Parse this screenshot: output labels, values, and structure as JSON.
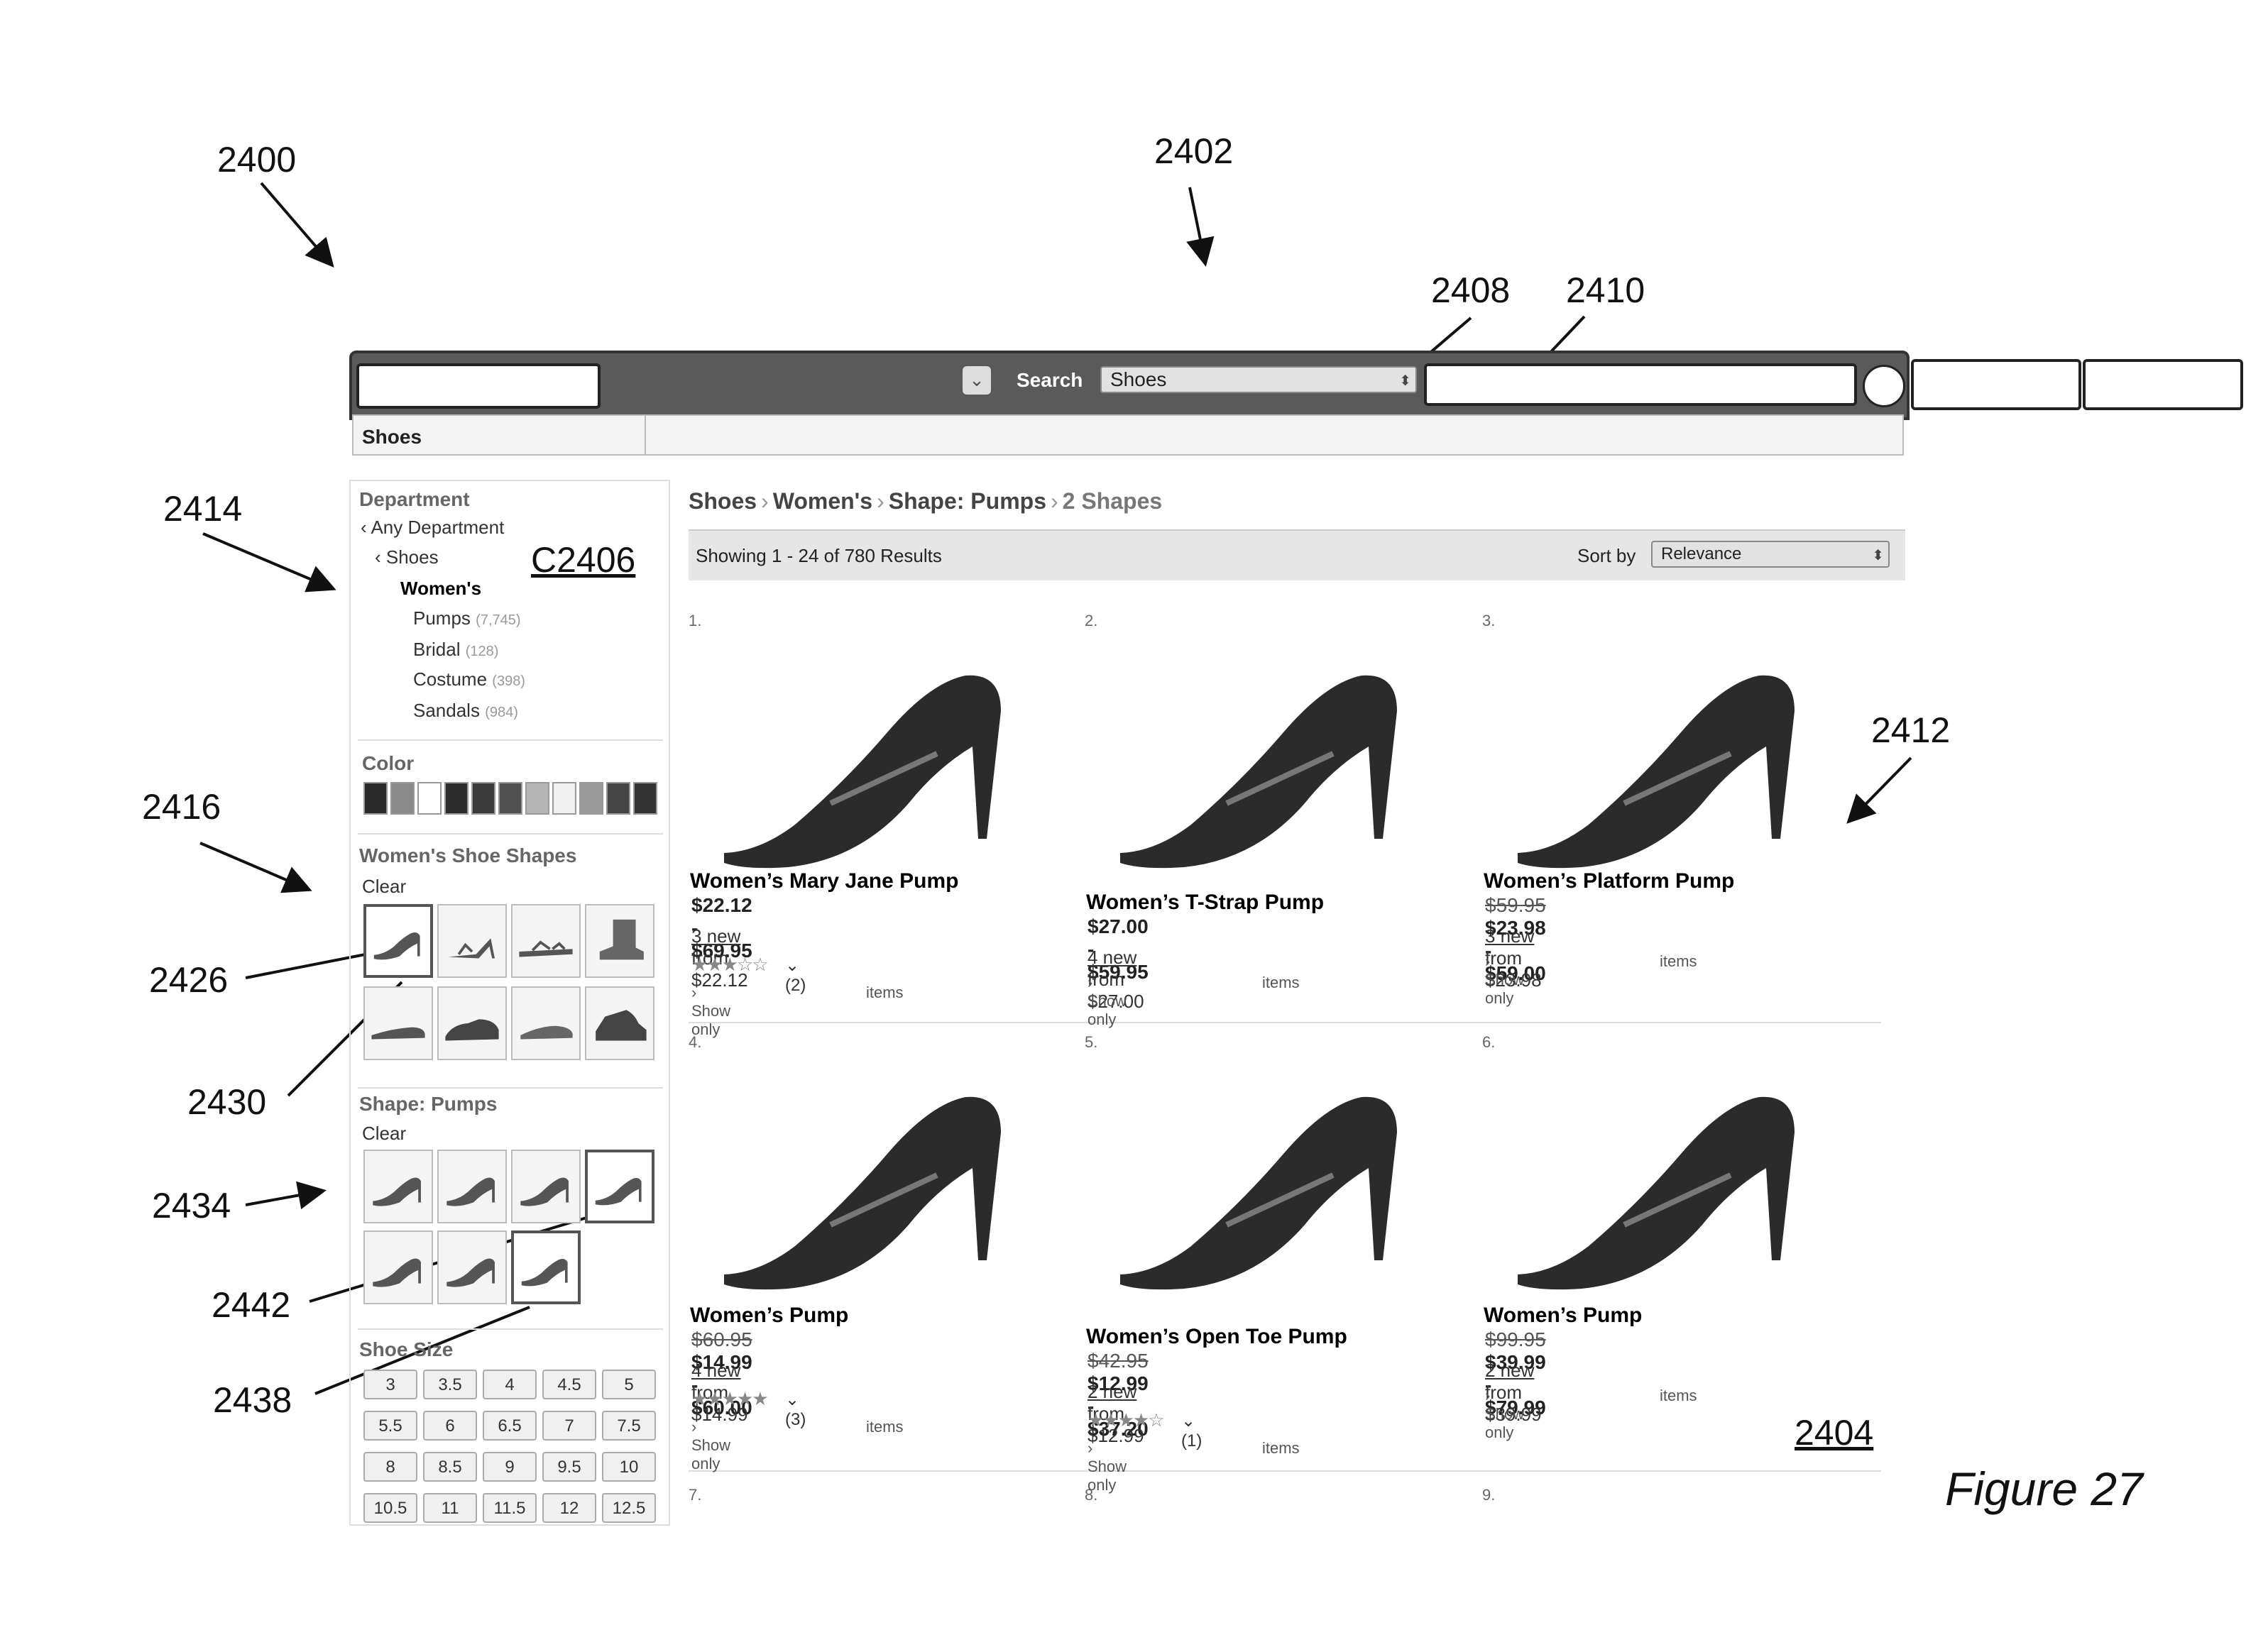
{
  "refs": {
    "r2400": "2400",
    "r2402": "2402",
    "r2408": "2408",
    "r2410": "2410",
    "r2414": "2414",
    "r2416": "2416",
    "r2426": "2426",
    "r2430": "2430",
    "r2434": "2434",
    "r2442": "2442",
    "r2438": "2438",
    "r2412": "2412",
    "c2406": "C2406",
    "r2404": "2404"
  },
  "figure_label": "Figure 27",
  "header": {
    "search_label": "Search",
    "category_value": "Shoes",
    "subtab": "Shoes"
  },
  "sidebar": {
    "department_heading": "Department",
    "any_department": "‹ Any Department",
    "shoes": "‹ Shoes",
    "womens": "Women's",
    "categories": [
      {
        "label": "Pumps",
        "count": "(7,745)"
      },
      {
        "label": "Bridal",
        "count": "(128)"
      },
      {
        "label": "Costume",
        "count": "(398)"
      },
      {
        "label": "Sandals",
        "count": "(984)"
      }
    ],
    "color_heading": "Color",
    "colors": [
      "#2a2a2a",
      "#8a8a8a",
      "#ffffff",
      "#2c2c2c",
      "#3a3a3a",
      "#505050",
      "#b5b5b5",
      "#efefef",
      "#9a9a9a",
      "#444444",
      "#333333"
    ],
    "shapes_heading": "Women's Shoe Shapes",
    "shapes_clear": "Clear",
    "pumps_heading": "Shape: Pumps",
    "pumps_clear": "Clear",
    "size_heading": "Shoe Size",
    "sizes": [
      "3",
      "3.5",
      "4",
      "4.5",
      "5",
      "5.5",
      "6",
      "6.5",
      "7",
      "7.5",
      "8",
      "8.5",
      "9",
      "9.5",
      "10",
      "10.5",
      "11",
      "11.5",
      "12",
      "12.5"
    ]
  },
  "main": {
    "breadcrumb": [
      "Shoes",
      "Women's",
      "Shape: Pumps",
      "2 Shapes"
    ],
    "results_text": "Showing 1 - 24 of 780 Results",
    "sort_label": "Sort by",
    "sort_value": "Relevance",
    "show_only": "› Show only",
    "items": "items",
    "products": [
      {
        "num": "1.",
        "name": "Women’s Mary Jane  Pump",
        "old_price": "",
        "price": "$22.12 - $69.95",
        "new_link": "3 new",
        "new_from": " from $22.12",
        "stars": "★★★☆☆",
        "reviews": "(2)"
      },
      {
        "num": "2.",
        "name": "Women’s T-Strap Pump",
        "old_price": "",
        "price": "$27.00 - $59.95",
        "new_link": "4 new",
        "new_from": " from $27.00",
        "stars": "",
        "reviews": ""
      },
      {
        "num": "3.",
        "name": "Women’s Platform Pump",
        "old_price": "$59.95",
        "price": "$23.98 - $59.00",
        "new_link": "3 new",
        "new_from": " from $23.98",
        "stars": "",
        "reviews": ""
      },
      {
        "num": "4.",
        "name": "Women’s Pump",
        "old_price": "$60.95",
        "price": "$14.99 - $60.00",
        "new_link": "4 new",
        "new_from": " from $14.99",
        "stars": "★★★★★",
        "reviews": "(3)"
      },
      {
        "num": "5.",
        "name": "Women’s Open Toe Pump",
        "old_price": "$42.95",
        "price": "$12.99 - $37.20",
        "new_link": "2 new",
        "new_from": " from $12.99",
        "stars": "★★★★☆",
        "reviews": "(1)"
      },
      {
        "num": "6.",
        "name": "Women’s Pump",
        "old_price": "$99.95",
        "price": "$39.99 - $79.99",
        "new_link": "2 new",
        "new_from": " from $39.99",
        "stars": "",
        "reviews": ""
      },
      {
        "num": "7."
      },
      {
        "num": "8."
      },
      {
        "num": "9."
      }
    ]
  }
}
